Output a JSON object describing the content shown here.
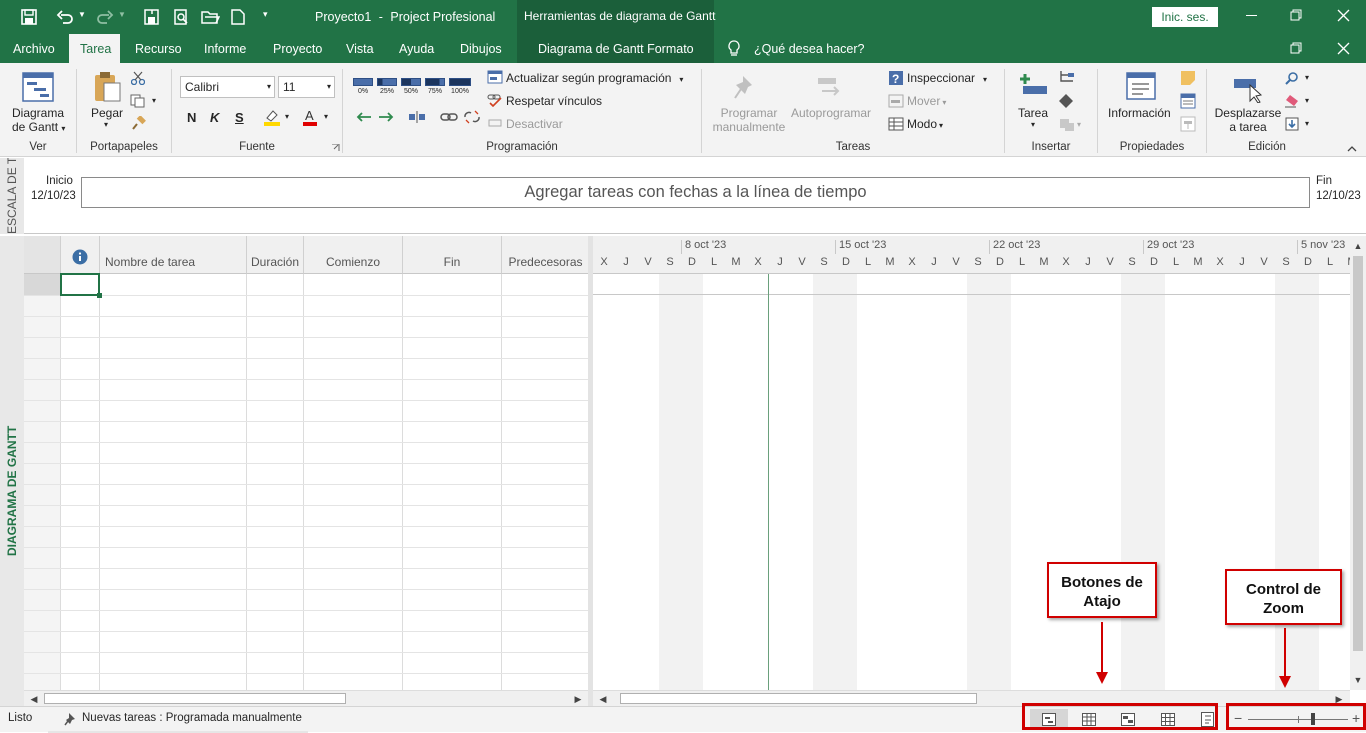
{
  "title": {
    "doc": "Proyecto1",
    "sep": "-",
    "app": "Project Profesional",
    "context": "Herramientas de diagrama de Gantt",
    "signin": "Inic. ses."
  },
  "tabs": [
    "Archivo",
    "Tarea",
    "Recurso",
    "Informe",
    "Proyecto",
    "Vista",
    "Ayuda",
    "Dibujos"
  ],
  "context_tab": "Diagrama de Gantt  Formato",
  "tell_me": "¿Qué desea hacer?",
  "ribbon": {
    "ver": {
      "btn1": "Diagrama",
      "btn2": "de Gantt",
      "group": "Ver"
    },
    "portapapeles": {
      "pegar": "Pegar",
      "group": "Portapapeles"
    },
    "fuente": {
      "font": "Calibri",
      "size": "11",
      "bold": "N",
      "italic": "K",
      "underline": "S",
      "group": "Fuente"
    },
    "programacion": {
      "pcts": [
        "0%",
        "25%",
        "50%",
        "75%",
        "100%"
      ],
      "actualizar": "Actualizar según programación",
      "respetar": "Respetar vínculos",
      "desactivar": "Desactivar",
      "group": "Programación"
    },
    "tareas": {
      "prog1": "Programar",
      "prog2": "manualmente",
      "auto": "Autoprogramar",
      "inspeccionar": "Inspeccionar",
      "mover": "Mover",
      "modo": "Modo",
      "group": "Tareas"
    },
    "insertar": {
      "tarea": "Tarea",
      "group": "Insertar"
    },
    "propiedades": {
      "info": "Información",
      "group": "Propiedades"
    },
    "edicion": {
      "desp1": "Desplazarse",
      "desp2": "a tarea",
      "group": "Edición"
    }
  },
  "timeline": {
    "side_label": "ESCALA DE T",
    "start_label": "Inicio",
    "start_date": "12/10/23",
    "end_label": "Fin",
    "end_date": "12/10/23",
    "placeholder": "Agregar tareas con fechas a la línea de tiempo"
  },
  "view_label": "DIAGRAMA DE GANTT",
  "grid": {
    "headers": [
      "Nombre de tarea",
      "Duración",
      "Comienzo",
      "Fin",
      "Predecesoras"
    ]
  },
  "chart": {
    "weeks": [
      "8 oct '23",
      "15 oct '23",
      "22 oct '23",
      "29 oct '23",
      "5 nov '23"
    ],
    "days": [
      "X",
      "J",
      "V",
      "S",
      "D",
      "L",
      "M",
      "X",
      "J",
      "V",
      "S",
      "D",
      "L",
      "M",
      "X",
      "J",
      "V",
      "S",
      "D",
      "L",
      "M",
      "X",
      "J",
      "V",
      "S",
      "D",
      "L",
      "M",
      "X",
      "J",
      "V",
      "S",
      "D",
      "L",
      "M"
    ]
  },
  "status": {
    "ready": "Listo",
    "new_tasks": "Nuevas tareas : Programada manualmente"
  },
  "callouts": {
    "shortcuts": "Botones de  Atajo",
    "zoom": "Control de Zoom"
  },
  "colors": {
    "brand": "#217346",
    "annotation": "#d00000"
  }
}
